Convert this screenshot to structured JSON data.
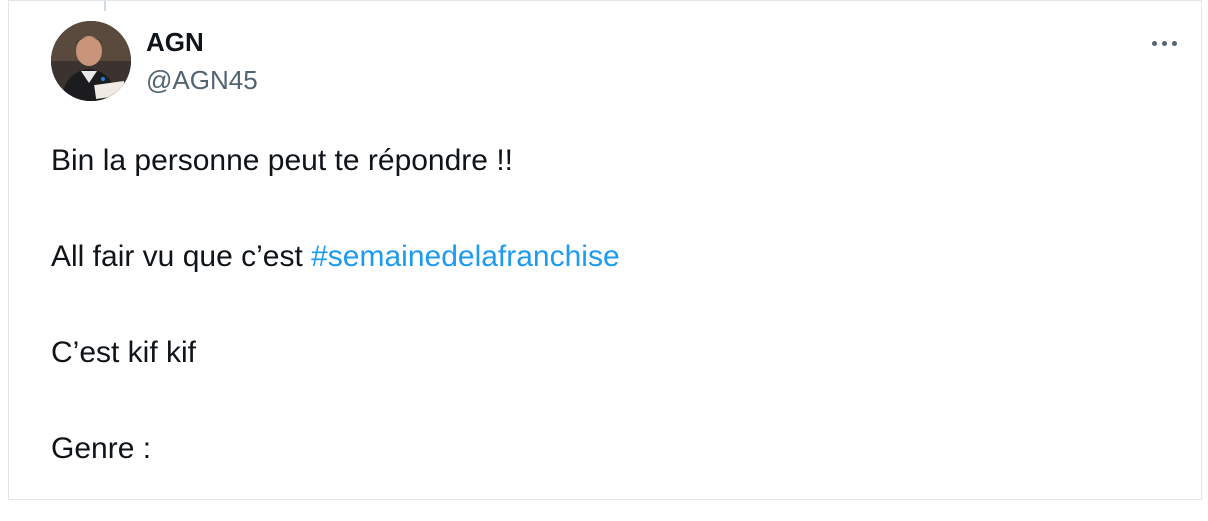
{
  "tweet": {
    "author_name": "AGN",
    "author_handle": "@AGN45",
    "avatar_icon": "profile-photo",
    "more_icon": "more-options-icon",
    "lines": {
      "line1": "Bin la personne peut te répondre !!",
      "line2_prefix": "All fair vu que c’est ",
      "line2_hashtag": "#semainedelafranchise",
      "line3": "C’est kif kif",
      "line4": "Genre :"
    }
  },
  "colors": {
    "text_primary": "#0f1419",
    "text_secondary": "#536471",
    "hashtag": "#1d9bf0",
    "border": "#e1e6ea"
  }
}
